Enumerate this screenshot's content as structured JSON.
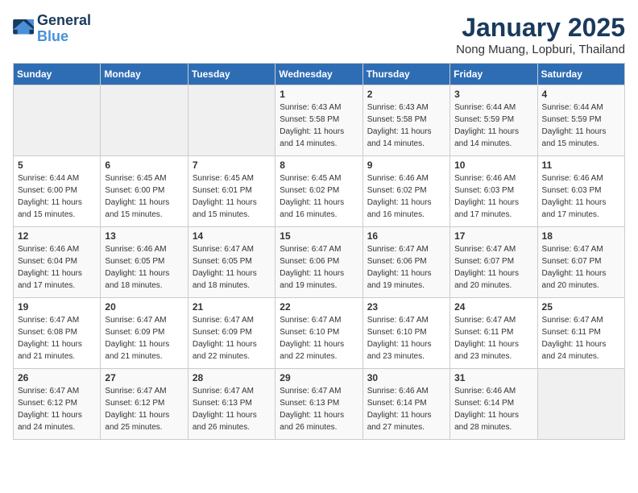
{
  "header": {
    "logo_line1": "General",
    "logo_line2": "Blue",
    "month_title": "January 2025",
    "location": "Nong Muang, Lopburi, Thailand"
  },
  "days_of_week": [
    "Sunday",
    "Monday",
    "Tuesday",
    "Wednesday",
    "Thursday",
    "Friday",
    "Saturday"
  ],
  "weeks": [
    [
      {
        "day": "",
        "sunrise": "",
        "sunset": "",
        "daylight": ""
      },
      {
        "day": "",
        "sunrise": "",
        "sunset": "",
        "daylight": ""
      },
      {
        "day": "",
        "sunrise": "",
        "sunset": "",
        "daylight": ""
      },
      {
        "day": "1",
        "sunrise": "Sunrise: 6:43 AM",
        "sunset": "Sunset: 5:58 PM",
        "daylight": "Daylight: 11 hours and 14 minutes."
      },
      {
        "day": "2",
        "sunrise": "Sunrise: 6:43 AM",
        "sunset": "Sunset: 5:58 PM",
        "daylight": "Daylight: 11 hours and 14 minutes."
      },
      {
        "day": "3",
        "sunrise": "Sunrise: 6:44 AM",
        "sunset": "Sunset: 5:59 PM",
        "daylight": "Daylight: 11 hours and 14 minutes."
      },
      {
        "day": "4",
        "sunrise": "Sunrise: 6:44 AM",
        "sunset": "Sunset: 5:59 PM",
        "daylight": "Daylight: 11 hours and 15 minutes."
      }
    ],
    [
      {
        "day": "5",
        "sunrise": "Sunrise: 6:44 AM",
        "sunset": "Sunset: 6:00 PM",
        "daylight": "Daylight: 11 hours and 15 minutes."
      },
      {
        "day": "6",
        "sunrise": "Sunrise: 6:45 AM",
        "sunset": "Sunset: 6:00 PM",
        "daylight": "Daylight: 11 hours and 15 minutes."
      },
      {
        "day": "7",
        "sunrise": "Sunrise: 6:45 AM",
        "sunset": "Sunset: 6:01 PM",
        "daylight": "Daylight: 11 hours and 15 minutes."
      },
      {
        "day": "8",
        "sunrise": "Sunrise: 6:45 AM",
        "sunset": "Sunset: 6:02 PM",
        "daylight": "Daylight: 11 hours and 16 minutes."
      },
      {
        "day": "9",
        "sunrise": "Sunrise: 6:46 AM",
        "sunset": "Sunset: 6:02 PM",
        "daylight": "Daylight: 11 hours and 16 minutes."
      },
      {
        "day": "10",
        "sunrise": "Sunrise: 6:46 AM",
        "sunset": "Sunset: 6:03 PM",
        "daylight": "Daylight: 11 hours and 17 minutes."
      },
      {
        "day": "11",
        "sunrise": "Sunrise: 6:46 AM",
        "sunset": "Sunset: 6:03 PM",
        "daylight": "Daylight: 11 hours and 17 minutes."
      }
    ],
    [
      {
        "day": "12",
        "sunrise": "Sunrise: 6:46 AM",
        "sunset": "Sunset: 6:04 PM",
        "daylight": "Daylight: 11 hours and 17 minutes."
      },
      {
        "day": "13",
        "sunrise": "Sunrise: 6:46 AM",
        "sunset": "Sunset: 6:05 PM",
        "daylight": "Daylight: 11 hours and 18 minutes."
      },
      {
        "day": "14",
        "sunrise": "Sunrise: 6:47 AM",
        "sunset": "Sunset: 6:05 PM",
        "daylight": "Daylight: 11 hours and 18 minutes."
      },
      {
        "day": "15",
        "sunrise": "Sunrise: 6:47 AM",
        "sunset": "Sunset: 6:06 PM",
        "daylight": "Daylight: 11 hours and 19 minutes."
      },
      {
        "day": "16",
        "sunrise": "Sunrise: 6:47 AM",
        "sunset": "Sunset: 6:06 PM",
        "daylight": "Daylight: 11 hours and 19 minutes."
      },
      {
        "day": "17",
        "sunrise": "Sunrise: 6:47 AM",
        "sunset": "Sunset: 6:07 PM",
        "daylight": "Daylight: 11 hours and 20 minutes."
      },
      {
        "day": "18",
        "sunrise": "Sunrise: 6:47 AM",
        "sunset": "Sunset: 6:07 PM",
        "daylight": "Daylight: 11 hours and 20 minutes."
      }
    ],
    [
      {
        "day": "19",
        "sunrise": "Sunrise: 6:47 AM",
        "sunset": "Sunset: 6:08 PM",
        "daylight": "Daylight: 11 hours and 21 minutes."
      },
      {
        "day": "20",
        "sunrise": "Sunrise: 6:47 AM",
        "sunset": "Sunset: 6:09 PM",
        "daylight": "Daylight: 11 hours and 21 minutes."
      },
      {
        "day": "21",
        "sunrise": "Sunrise: 6:47 AM",
        "sunset": "Sunset: 6:09 PM",
        "daylight": "Daylight: 11 hours and 22 minutes."
      },
      {
        "day": "22",
        "sunrise": "Sunrise: 6:47 AM",
        "sunset": "Sunset: 6:10 PM",
        "daylight": "Daylight: 11 hours and 22 minutes."
      },
      {
        "day": "23",
        "sunrise": "Sunrise: 6:47 AM",
        "sunset": "Sunset: 6:10 PM",
        "daylight": "Daylight: 11 hours and 23 minutes."
      },
      {
        "day": "24",
        "sunrise": "Sunrise: 6:47 AM",
        "sunset": "Sunset: 6:11 PM",
        "daylight": "Daylight: 11 hours and 23 minutes."
      },
      {
        "day": "25",
        "sunrise": "Sunrise: 6:47 AM",
        "sunset": "Sunset: 6:11 PM",
        "daylight": "Daylight: 11 hours and 24 minutes."
      }
    ],
    [
      {
        "day": "26",
        "sunrise": "Sunrise: 6:47 AM",
        "sunset": "Sunset: 6:12 PM",
        "daylight": "Daylight: 11 hours and 24 minutes."
      },
      {
        "day": "27",
        "sunrise": "Sunrise: 6:47 AM",
        "sunset": "Sunset: 6:12 PM",
        "daylight": "Daylight: 11 hours and 25 minutes."
      },
      {
        "day": "28",
        "sunrise": "Sunrise: 6:47 AM",
        "sunset": "Sunset: 6:13 PM",
        "daylight": "Daylight: 11 hours and 26 minutes."
      },
      {
        "day": "29",
        "sunrise": "Sunrise: 6:47 AM",
        "sunset": "Sunset: 6:13 PM",
        "daylight": "Daylight: 11 hours and 26 minutes."
      },
      {
        "day": "30",
        "sunrise": "Sunrise: 6:46 AM",
        "sunset": "Sunset: 6:14 PM",
        "daylight": "Daylight: 11 hours and 27 minutes."
      },
      {
        "day": "31",
        "sunrise": "Sunrise: 6:46 AM",
        "sunset": "Sunset: 6:14 PM",
        "daylight": "Daylight: 11 hours and 28 minutes."
      },
      {
        "day": "",
        "sunrise": "",
        "sunset": "",
        "daylight": ""
      }
    ]
  ]
}
